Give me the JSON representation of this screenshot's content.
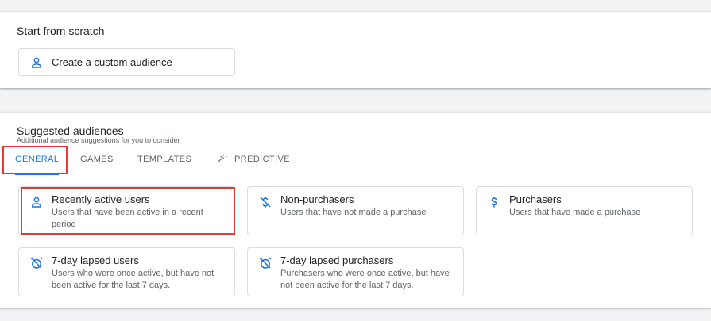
{
  "start_section": {
    "title": "Start from scratch",
    "custom_tile": {
      "label": "Create a custom audience",
      "icon": "person-icon"
    }
  },
  "suggested_section": {
    "title": "Suggested audiences",
    "subtitle": "Additional audience suggestions for you to consider",
    "tabs": [
      {
        "label": "GENERAL",
        "active": true
      },
      {
        "label": "GAMES",
        "active": false
      },
      {
        "label": "TEMPLATES",
        "active": false
      },
      {
        "label": "PREDICTIVE",
        "active": false,
        "icon": "magic-wand-icon"
      }
    ],
    "audiences": [
      {
        "title": "Recently active users",
        "description": "Users that have been active in a recent period",
        "icon": "person-icon"
      },
      {
        "title": "Non-purchasers",
        "description": "Users that have not made a purchase",
        "icon": "no-dollar-icon"
      },
      {
        "title": "Purchasers",
        "description": "Users that have made a purchase",
        "icon": "dollar-icon"
      },
      {
        "title": "7-day lapsed users",
        "description": "Users who were once active, but have not been active for the last 7 days.",
        "icon": "alarm-off-icon"
      },
      {
        "title": "7-day lapsed purchasers",
        "description": "Purchasers who were once active, but have not been active for the last 7 days.",
        "icon": "alarm-off-icon"
      }
    ]
  },
  "colors": {
    "accent": "#1a73e8",
    "highlight": "#e53935",
    "background": "#f1f3f4"
  }
}
